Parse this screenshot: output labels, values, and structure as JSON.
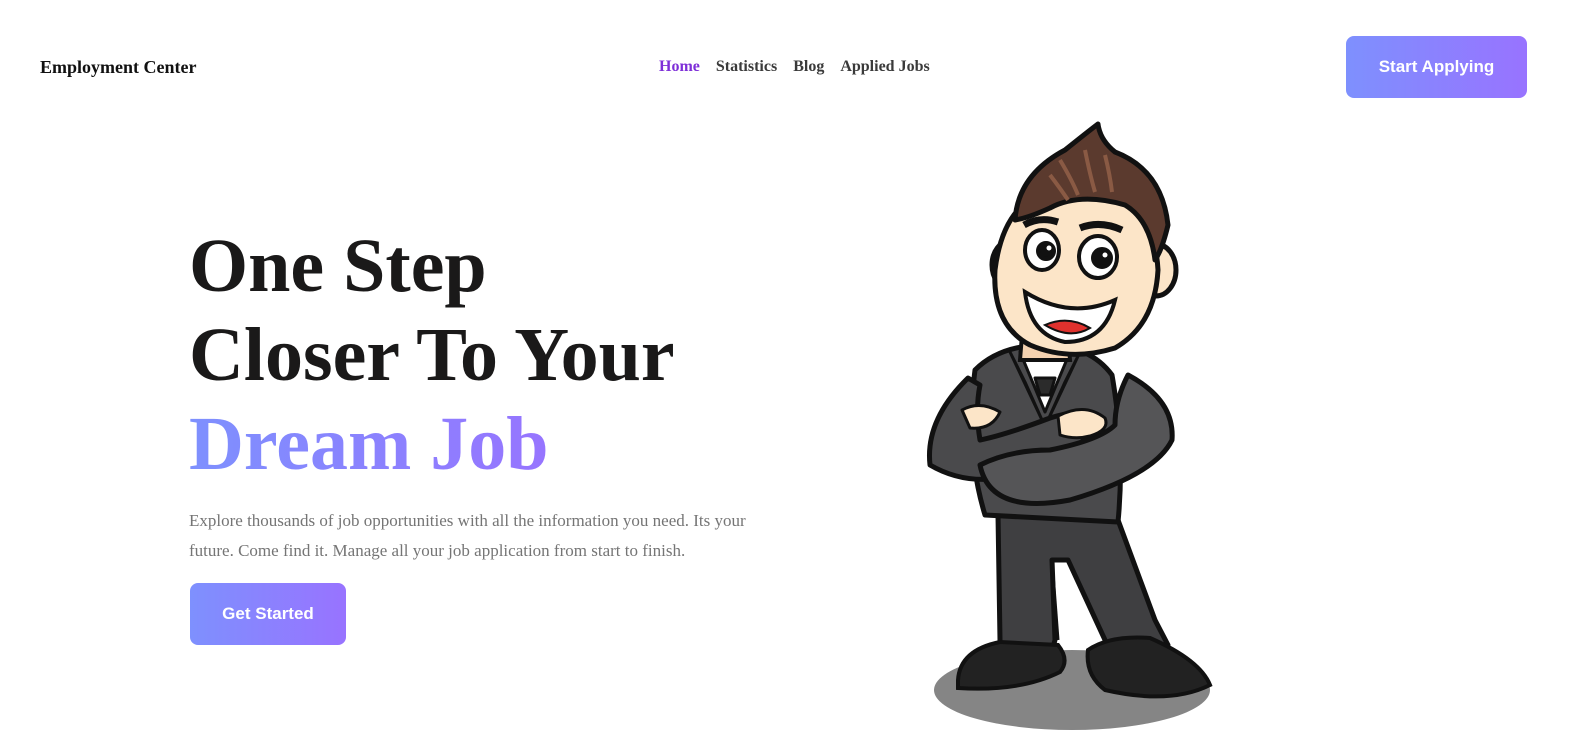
{
  "header": {
    "brand": "Employment Center",
    "nav": [
      {
        "label": "Home",
        "active": true
      },
      {
        "label": "Statistics",
        "active": false
      },
      {
        "label": "Blog",
        "active": false
      },
      {
        "label": "Applied Jobs",
        "active": false
      }
    ],
    "cta_label": "Start Applying"
  },
  "hero": {
    "title_line1": "One Step",
    "title_line2": "Closer To Your",
    "title_highlight": "Dream Job",
    "description": "Explore thousands of job opportunities with all the information you need. Its your future. Come find it. Manage all your job application from start to finish.",
    "button_label": "Get Started",
    "illustration": "businessman-mascot-illustration"
  },
  "colors": {
    "accent_start": "#7E90FE",
    "accent_end": "#9873FF",
    "nav_active": "#7E2FD8",
    "heading": "#1A1919",
    "body_text": "#757575"
  }
}
